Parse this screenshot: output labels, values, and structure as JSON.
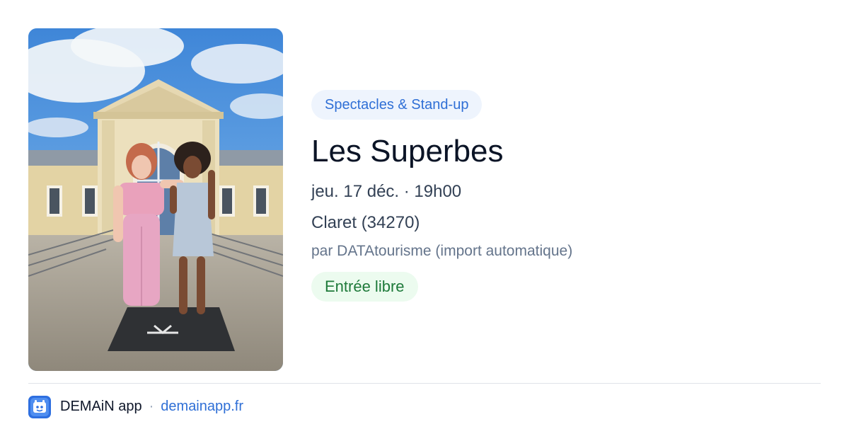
{
  "event": {
    "category": "Spectacles & Stand-up",
    "title": "Les Superbes",
    "datetime": "jeu. 17 déc. · 19h00",
    "location": "Claret (34270)",
    "source": "par DATAtourisme (import automatique)",
    "price": "Entrée libre",
    "photo_icon": "event-photo"
  },
  "footer": {
    "app_name": "DEMAiN app",
    "separator": "·",
    "link": "demainapp.fr",
    "app_icon": "demain-app-icon"
  },
  "colors": {
    "accent": "#2f6fd6",
    "category_chip_bg": "#eef4fd",
    "price_chip_bg": "#ecfbef",
    "price_text": "#1e7a3a",
    "title_text": "#0b1426",
    "muted_text": "#64748b",
    "divider": "#dfe3e8"
  }
}
